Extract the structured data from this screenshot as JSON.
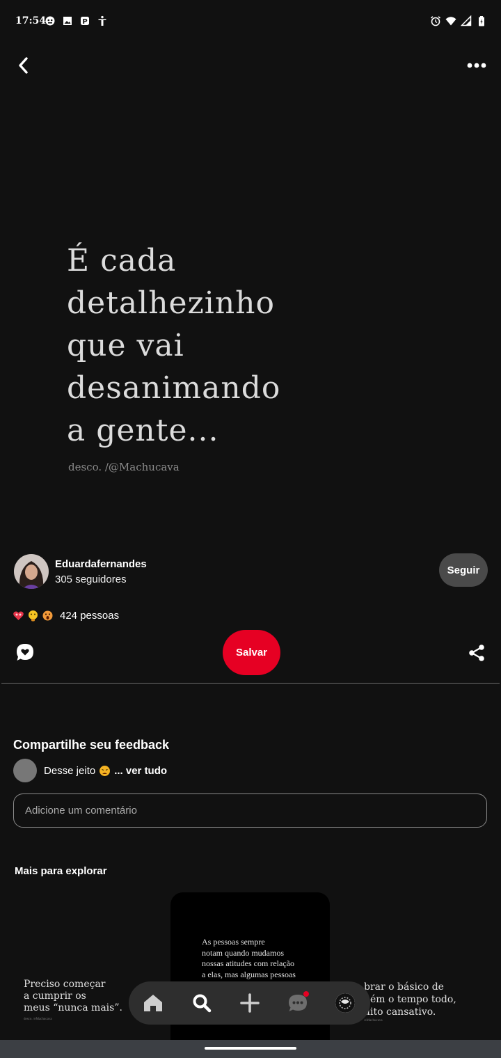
{
  "status_bar": {
    "time": "17:54",
    "left_icons": [
      "face-mask-icon",
      "image-icon",
      "parking-icon",
      "accessibility-icon"
    ],
    "right_icons": [
      "alarm-icon",
      "wifi-icon",
      "signal-icon",
      "battery-icon"
    ]
  },
  "top_bar": {
    "back_icon": "chevron-left-icon",
    "more_icon": "more-horizontal-icon"
  },
  "pin": {
    "quote": "É cada\ndetalhezinho\nque vai\ndesanimando\na gente...",
    "credit": "desco. /@Machucava"
  },
  "creator": {
    "name": "Eduardafernandes",
    "followers": "305 seguidores",
    "follow_label": "Seguir"
  },
  "reactions": {
    "emojis": [
      "heart-eyes-emoji",
      "thinking-emoji",
      "shocked-emoji"
    ],
    "count_text": "424 pessoas"
  },
  "actions": {
    "save_label": "Salvar",
    "comment_icon": "comment-bubble-icon",
    "share_icon": "share-icon"
  },
  "feedback": {
    "title": "Compartilhe seu feedback",
    "comment_text": "Desse jeito",
    "comment_emoji": "tired-face-emoji",
    "see_all": "... ver tudo",
    "input_placeholder": "Adicione um comentário"
  },
  "explore": {
    "title": "Mais para explorar",
    "cards": [
      {
        "text": "Preciso começar\na cumprir os\nmeus “nunca mais”.",
        "credit": "desco. /eMachucava"
      },
      {
        "text": "As pessoas sempre\nnotam quando mudamos\nnossas atitudes com relação\na elas, mas algumas pessoas",
        "credit": ""
      },
      {
        "text": "brar o básico de\nbém o tempo todo,\nuito cansativo.",
        "credit": "/eMachucava"
      }
    ]
  },
  "bottom_nav": {
    "items": [
      "home-icon",
      "search-icon",
      "plus-icon",
      "messages-icon",
      "profile-avatar"
    ],
    "accent": "#e60023"
  },
  "colors": {
    "background": "#111111",
    "accent": "#e60023",
    "follow_button": "#4a4a4a"
  }
}
